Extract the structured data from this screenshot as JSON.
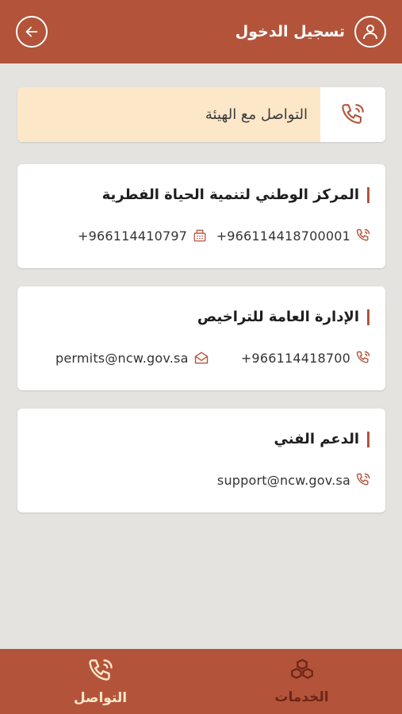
{
  "header": {
    "title": "تسجيل الدخول",
    "user_icon": "user-icon",
    "back_icon": "arrow-left-icon"
  },
  "banner": {
    "label": "التواصل مع الهيئة",
    "icon": "phone-ringing-icon"
  },
  "cards": [
    {
      "title": "المركز الوطني لتنمية الحياة الفطرية",
      "phone": "+966114418700001",
      "fax": "+966114410797"
    },
    {
      "title": "الإدارة العامة للتراخيص",
      "phone": "+966114418700",
      "email": "permits@ncw.gov.sa"
    },
    {
      "title": "الدعم الفني",
      "email": "support@ncw.gov.sa"
    }
  ],
  "tabs": [
    {
      "label": "التواصل",
      "icon": "phone-ringing-icon",
      "active": true
    },
    {
      "label": "الخدمات",
      "icon": "boxes-icon",
      "active": false
    }
  ],
  "colors": {
    "brand": "#b3543a",
    "tab_active": "#fde7c9",
    "tab_inactive": "#6e2516",
    "banner_bg": "#fde7c9"
  }
}
